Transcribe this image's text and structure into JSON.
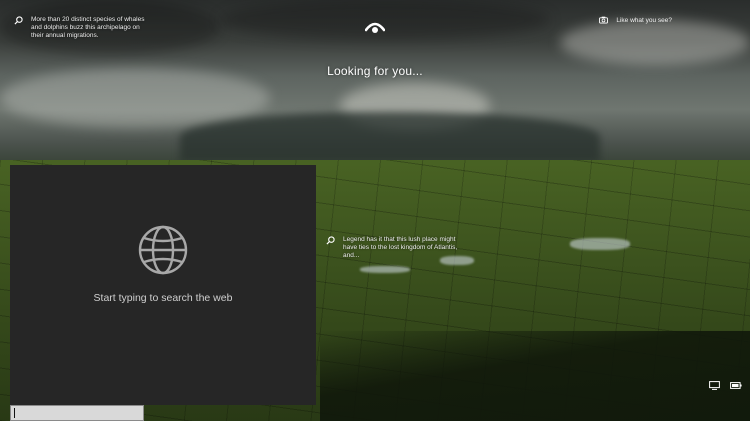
{
  "spotlight": {
    "top_fact": "More than 20 distinct species of whales\nand dolphins buzz this archipelago on\ntheir annual migrations.",
    "side_fact": "Legend has it that this lush place might\nhave ties to the lost kingdom of Atlantis,\nand...",
    "like_label": "Like what you see?"
  },
  "windows_hello": {
    "status": "Looking for you..."
  },
  "search_panel": {
    "hint": "Start typing to search the web",
    "input_value": ""
  },
  "icons": {
    "fact": "search-pin-icon",
    "like": "camera-icon",
    "hello": "windows-hello-eye-icon",
    "globe": "globe-icon",
    "network": "network-icon",
    "power": "battery-icon"
  }
}
